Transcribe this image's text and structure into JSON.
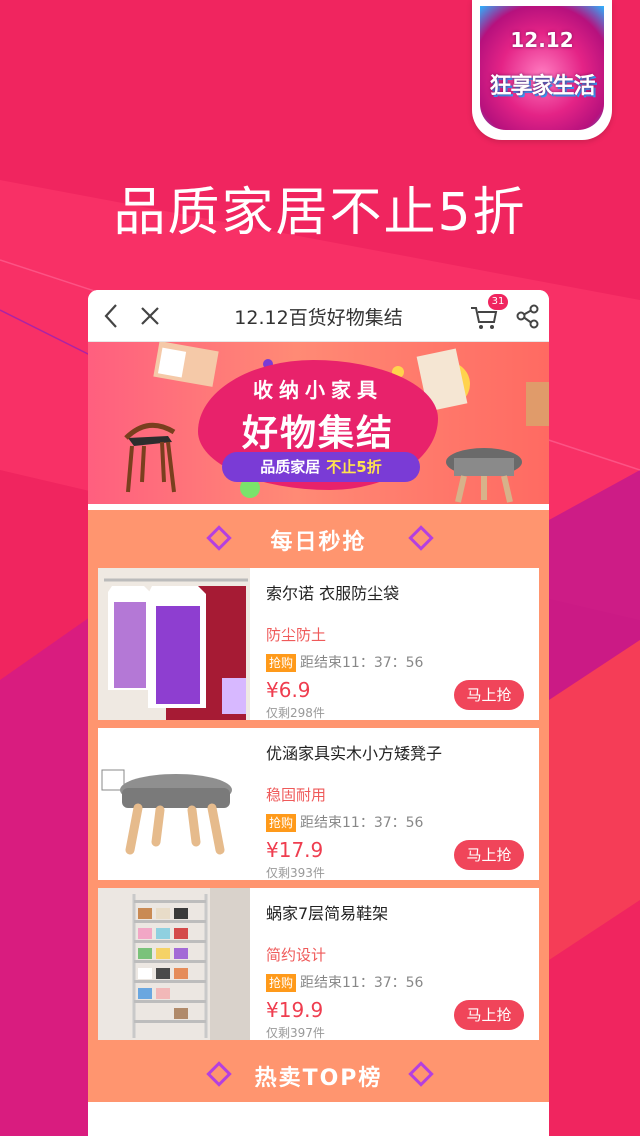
{
  "colors": {
    "background": "#f0255f",
    "accent": "#ff956f",
    "buy_button": "#f0455a",
    "price": "#ef3d4f",
    "banner_pill": "#7a3bd6"
  },
  "badge": {
    "top_text": "12.12",
    "bottom_text": "狂享家生活"
  },
  "headline": "品质家居不止5折",
  "nav": {
    "title": "12.12百货好物集结",
    "cart_count": "31",
    "back_icon": "chevron-left-icon",
    "close_icon": "close-icon",
    "cart_icon": "cart-icon",
    "share_icon": "share-icon"
  },
  "banner": {
    "line1": "收纳小家具",
    "line2": "好物集结",
    "pill_left": "品质家居",
    "pill_right": "不止5折"
  },
  "daily_section": {
    "title": "每日秒抢"
  },
  "products": [
    {
      "name": "索尔诺 衣服防尘袋",
      "tag": "防尘防土",
      "flash_label": "抢购",
      "countdown": "距结束11：37：56",
      "price": "¥6.9",
      "remaining": "仅剩298件",
      "button": "马上抢"
    },
    {
      "name": "优涵家具实木小方矮凳子",
      "tag": "稳固耐用",
      "flash_label": "抢购",
      "countdown": "距结束11：37：56",
      "price": "¥17.9",
      "remaining": "仅剩393件",
      "button": "马上抢"
    },
    {
      "name": "蜗家7层简易鞋架",
      "tag": "简约设计",
      "flash_label": "抢购",
      "countdown": "距结束11：37：56",
      "price": "¥19.9",
      "remaining": "仅剩397件",
      "button": "马上抢"
    }
  ],
  "top_section": {
    "title": "热卖TOP榜"
  }
}
